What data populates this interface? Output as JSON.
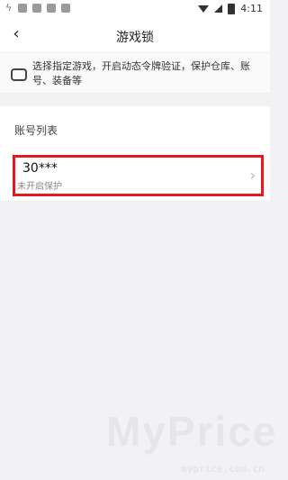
{
  "status_bar": {
    "time": "4:11"
  },
  "header": {
    "title": "游戏锁",
    "back_icon": "back-arrow-icon"
  },
  "info_banner": {
    "icon": "gamepad-icon",
    "text": "选择指定游戏，开启动态令牌验证，保护仓库、账号、装备等"
  },
  "account_list": {
    "title": "账号列表",
    "items": [
      {
        "account": "30***",
        "status": "未开启保护"
      }
    ]
  },
  "watermark": {
    "brand": "MyPrice",
    "url": "myprice.com.cn"
  },
  "colors": {
    "highlight": "#e01b24",
    "background": "#f2f2f4"
  }
}
